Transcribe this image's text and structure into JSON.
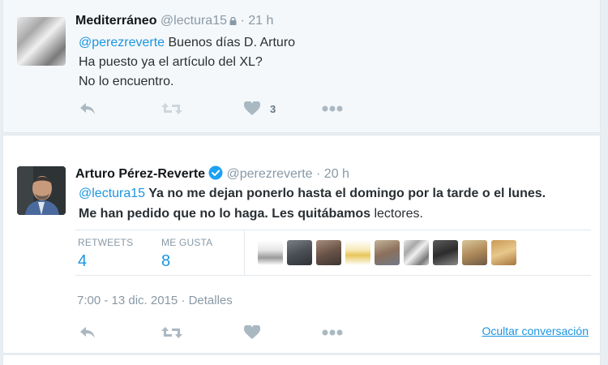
{
  "tweet1": {
    "fullname": "Mediterráneo",
    "handle": "@lectura15",
    "time": "· 21 h",
    "mention": "@perezreverte",
    "line1_rest": " Buenos días D. Arturo",
    "line2": "Ha puesto ya el artículo del XL?",
    "line3": "No lo encuentro.",
    "like_count": "3"
  },
  "tweet2": {
    "fullname": "Arturo Pérez-Reverte",
    "handle": "@perezreverte",
    "time": "· 20 h",
    "mention": "@lectura15",
    "text_bold": " Ya no me dejan ponerlo hasta el domingo por la tarde o el lunes. Me han pedido que no lo haga. Les quitábamos",
    "text_light": " lectores.",
    "retweets_label": "RETWEETS",
    "retweets_value": "4",
    "likes_label": "ME GUSTA",
    "likes_value": "8",
    "timestamp": "7:00 - 13 dic. 2015 · Detalles",
    "hide_conversation": "Ocultar conversación"
  },
  "colors": {
    "link": "#1b95e0",
    "muted": "#8899a6",
    "icon": "#aab8c2",
    "verified": "#1da1f2"
  },
  "icons": [
    "reply-icon",
    "retweet-icon",
    "like-icon",
    "more-icon",
    "lock-icon",
    "verified-icon"
  ]
}
